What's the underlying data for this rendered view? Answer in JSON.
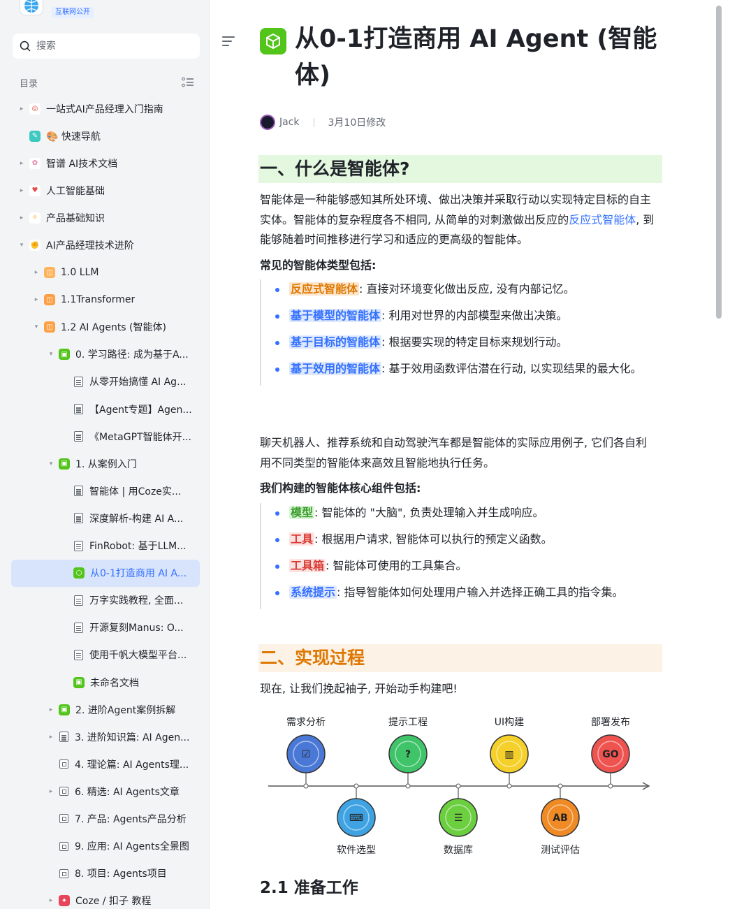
{
  "sidebar": {
    "badge": "互联网公开",
    "search_placeholder": "搜索",
    "toc_label": "目录",
    "items": [
      {
        "label": "一站式AI产品经理入门指南",
        "icon": "dartboard-emoji-icon"
      },
      {
        "label": "🎨 快速导航",
        "icon": "sparkle-doc-icon"
      },
      {
        "label": "智谱 AI技术文档",
        "icon": "rabbit-emoji-icon"
      },
      {
        "label": "人工智能基础",
        "icon": "heart-eyes-emoji-icon"
      },
      {
        "label": "产品基础知识",
        "icon": "dizzy-emoji-icon"
      },
      {
        "label": "AI产品经理技术进阶",
        "icon": "flexed-biceps-emoji-icon"
      },
      {
        "label": "1.0 LLM",
        "icon": "orange-doc-icon"
      },
      {
        "label": "1.1Transformer",
        "icon": "orange-doc-icon"
      },
      {
        "label": "1.2 AI Agents (智能体)",
        "icon": "orange-doc-icon"
      },
      {
        "label": "0. 学习路径: 成为基于A...",
        "icon": "green-board-icon"
      },
      {
        "label": "从零开始搞懂 AI Ag...",
        "icon": "doc-icon"
      },
      {
        "label": "【Agent专题】Agen...",
        "icon": "doc-icon"
      },
      {
        "label": "《MetaGPT智能体开...",
        "icon": "doc-icon"
      },
      {
        "label": "1. 从案例入门",
        "icon": "green-board-icon"
      },
      {
        "label": "智能体 | 用Coze实...",
        "icon": "doc-icon"
      },
      {
        "label": "深度解析-构建 AI A...",
        "icon": "doc-icon"
      },
      {
        "label": "FinRobot: 基于LLM...",
        "icon": "doc-icon"
      },
      {
        "label": "从0-1打造商用 AI A...",
        "icon": "green-cube-icon"
      },
      {
        "label": "万字实践教程, 全面...",
        "icon": "doc-icon"
      },
      {
        "label": "开源复刻Manus: O...",
        "icon": "doc-icon"
      },
      {
        "label": "使用千帆大模型平台...",
        "icon": "doc-icon"
      },
      {
        "label": "未命名文档",
        "icon": "green-board-icon"
      },
      {
        "label": "2. 进阶Agent案例拆解",
        "icon": "green-board-icon"
      },
      {
        "label": "3. 进阶知识篇: AI Agen...",
        "icon": "doc-icon"
      },
      {
        "label": "4. 理论篇: AI Agents理...",
        "icon": "box-doc-icon"
      },
      {
        "label": "6. 精选: AI Agents文章",
        "icon": "box-doc-icon"
      },
      {
        "label": "7. 产品: Agents产品分析",
        "icon": "box-doc-icon"
      },
      {
        "label": "9. 应用: AI Agents全景图",
        "icon": "box-doc-icon"
      },
      {
        "label": "8. 项目: Agents项目",
        "icon": "box-doc-icon"
      },
      {
        "label": "Coze / 扣子 教程",
        "icon": "coze-emoji-icon"
      }
    ]
  },
  "doc": {
    "title": "从0-1打造商用 AI Agent (智能体)",
    "author": "Jack",
    "modified": "3月10日修改",
    "section1": "一、什么是智能体?",
    "p1_a": "智能体是一种能够感知其所处环境、做出决策并采取行动以实现特定目标的自主实体。智能体的复杂程度各不相同, 从简单的对刺激做出反应的",
    "p1_link": "反应式智能体",
    "p1_b": ", 到能够随着时间推移进行学习和适应的更高级的智能体。",
    "types_heading": "常见的智能体类型包括:",
    "types": [
      {
        "name": "反应式智能体",
        "desc": ": 直接对环境变化做出反应, 没有内部记忆。"
      },
      {
        "name": "基于模型的智能体",
        "desc": ": 利用对世界的内部模型来做出决策。"
      },
      {
        "name": "基于目标的智能体",
        "desc": ": 根据要实现的特定目标来规划行动。"
      },
      {
        "name": "基于效用的智能体",
        "desc": ": 基于效用函数评估潜在行动, 以实现结果的最大化。"
      }
    ],
    "p2": "聊天机器人、推荐系统和自动驾驶汽车都是智能体的实际应用例子, 它们各自利用不同类型的智能体来高效且智能地执行任务。",
    "components_heading": "我们构建的智能体核心组件包括:",
    "components": [
      {
        "name": "模型",
        "desc": ": 智能体的 \"大脑\", 负责处理输入并生成响应。"
      },
      {
        "name": "工具",
        "desc": ": 根据用户请求, 智能体可以执行的预定义函数。"
      },
      {
        "name": "工具箱",
        "desc": ": 智能体可使用的工具集合。"
      },
      {
        "name": "系统提示",
        "desc": ": 指导智能体如何处理用户输入并选择正确工具的指令集。"
      }
    ],
    "section2": "二、实现过程",
    "p3": "现在, 让我们挽起袖子, 开始动手构建吧!",
    "timeline": {
      "top": [
        {
          "label": "需求分析",
          "color": "#4a78d6",
          "icon": "checklist-icon"
        },
        {
          "label": "提示工程",
          "color": "#3fc46a",
          "icon": "lightbulb-icon"
        },
        {
          "label": "UI构建",
          "color": "#f5d02a",
          "icon": "layout-icon"
        },
        {
          "label": "部署发布",
          "color": "#ef5350",
          "icon": "go-sign-icon"
        }
      ],
      "bottom": [
        {
          "label": "软件选型",
          "color": "#3fa3e3",
          "icon": "phone-code-icon"
        },
        {
          "label": "数据库",
          "color": "#6bcf3f",
          "icon": "database-icon"
        },
        {
          "label": "测试评估",
          "color": "#f08a24",
          "icon": "ab-test-icon"
        }
      ]
    },
    "section2_1": "2.1 准备工作"
  },
  "colors": {
    "accent": "#3370ff",
    "section1_bg": "#e4f7df",
    "section2_bg": "#fdf2e6",
    "section2_fg": "#de7802"
  }
}
